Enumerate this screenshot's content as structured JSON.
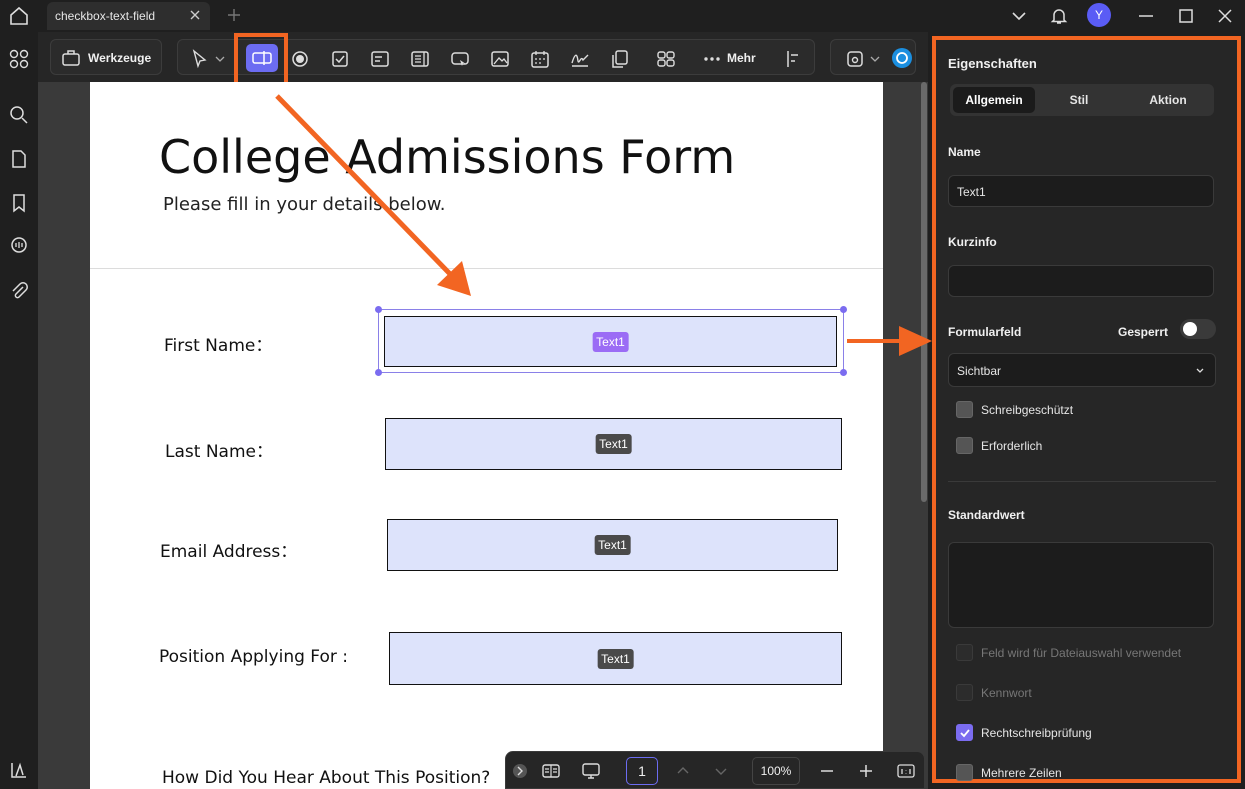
{
  "titlebar": {
    "tab_label": "checkbox-text-field",
    "avatar_initial": "Y"
  },
  "toolbar": {
    "werkzeuge_label": "Werkzeuge",
    "mehr_label": "Mehr"
  },
  "document": {
    "title": "College Admissions Form",
    "subtitle": "Please fill in your details below.",
    "fields": [
      {
        "label": "First Name：",
        "chip": "Text1"
      },
      {
        "label": "Last Name：",
        "chip": "Text1"
      },
      {
        "label": "Email Address：",
        "chip": "Text1"
      },
      {
        "label": "Position Applying For :",
        "chip": "Text1"
      }
    ],
    "question_label": "How Did You Hear About This Position?"
  },
  "bottombar": {
    "page_number": "1",
    "zoom": "100%"
  },
  "panel": {
    "title": "Eigenschaften",
    "tabs": [
      "Allgemein",
      "Stil",
      "Aktion"
    ],
    "active_tab": "Allgemein",
    "name_label": "Name",
    "name_value": "Text1",
    "kurzinfo_label": "Kurzinfo",
    "kurzinfo_value": "",
    "formularfeld_label": "Formularfeld",
    "gesperrt_label": "Gesperrt",
    "visibility_value": "Sichtbar",
    "checkboxes_top": [
      {
        "label": "Schreibgeschützt",
        "checked": false
      },
      {
        "label": "Erforderlich",
        "checked": false
      }
    ],
    "standardwert_label": "Standardwert",
    "checkboxes_bottom": [
      {
        "label": "Feld wird für Dateiauswahl verwendet",
        "checked": false,
        "disabled": true
      },
      {
        "label": "Kennwort",
        "checked": false,
        "disabled": true
      },
      {
        "label": "Rechtschreibprüfung",
        "checked": true,
        "disabled": false
      },
      {
        "label": "Mehrere Zeilen",
        "checked": false,
        "disabled": false
      }
    ]
  },
  "colors": {
    "accent": "#6c6cf2",
    "annotation": "#f26522",
    "field_fill": "#dde3fb"
  }
}
